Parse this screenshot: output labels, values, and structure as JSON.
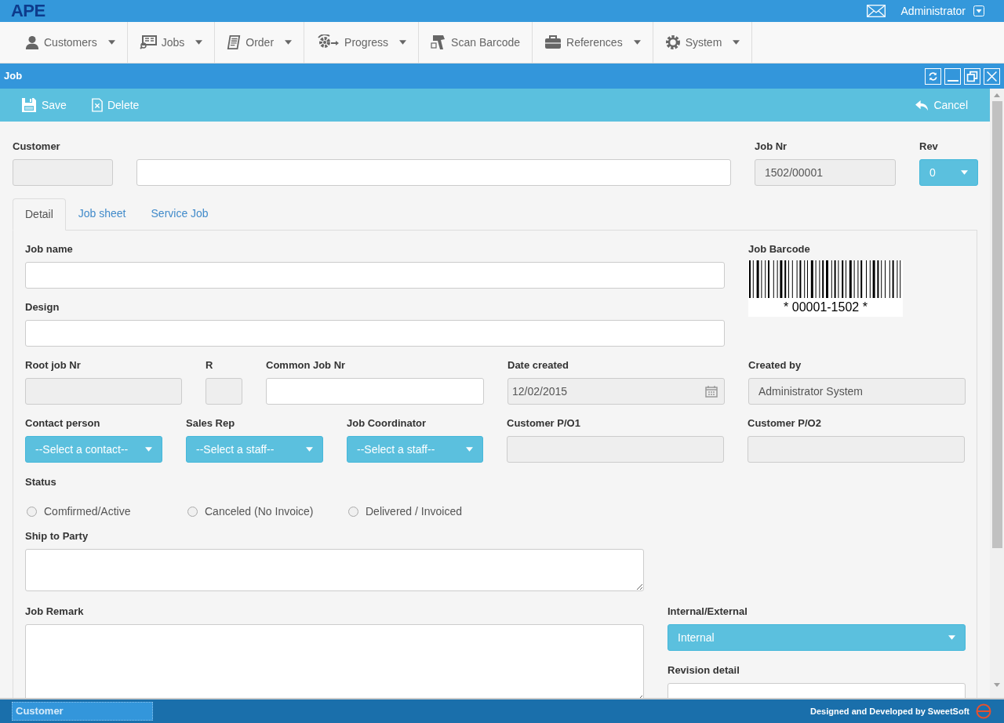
{
  "app": {
    "logo": "APE",
    "user": "Administrator"
  },
  "nav": [
    {
      "label": "Customers",
      "dropdown": true
    },
    {
      "label": "Jobs",
      "dropdown": true
    },
    {
      "label": "Order",
      "dropdown": true
    },
    {
      "label": "Progress",
      "dropdown": true
    },
    {
      "label": "Scan Barcode",
      "dropdown": false
    },
    {
      "label": "References",
      "dropdown": true
    },
    {
      "label": "System",
      "dropdown": true
    }
  ],
  "window": {
    "title": "Job"
  },
  "toolbar": {
    "actions": [
      "Save",
      "Delete"
    ],
    "cancel": "Cancel"
  },
  "header_fields": [
    {
      "kind": "text",
      "label": "Customer",
      "readonly": true
    },
    {
      "kind": "text",
      "readonly": false
    },
    {
      "kind": "text",
      "label": "Job Nr",
      "value": "1502/00001",
      "readonly": true
    },
    {
      "kind": "select",
      "label": "Rev",
      "value": "0"
    }
  ],
  "tabs": [
    {
      "label": "Detail",
      "selected": true
    },
    {
      "label": "Job sheet",
      "selected": false
    },
    {
      "label": "Service Job",
      "selected": false
    }
  ],
  "detail": {
    "top": [
      {
        "kind": "text",
        "label": "Job name",
        "readonly": false
      },
      {
        "kind": "text",
        "label": "Design",
        "readonly": false
      }
    ],
    "barcode": {
      "label": "Job Barcode",
      "text": "* 00001-1502 *"
    },
    "rows": [
      [
        {
          "kind": "text",
          "label": "Root job Nr",
          "readonly": true
        },
        {
          "kind": "text",
          "label": "R",
          "readonly": true
        },
        {
          "kind": "text",
          "label": "Common Job Nr",
          "readonly": false
        },
        {
          "kind": "date",
          "label": "Date created",
          "value": "12/02/2015",
          "readonly": true
        },
        {
          "kind": "text",
          "label": "Created by",
          "value": "Administrator System",
          "readonly": true
        }
      ],
      [
        {
          "kind": "select",
          "label": "Contact person",
          "value": "--Select a contact--"
        },
        {
          "kind": "select",
          "label": "Sales Rep",
          "value": "--Select a staff--"
        },
        {
          "kind": "select",
          "label": "Job Coordinator",
          "value": "--Select a staff--"
        },
        {
          "kind": "text",
          "label": "Customer P/O1",
          "readonly": true
        },
        {
          "kind": "text",
          "label": "Customer P/O2",
          "readonly": true
        }
      ]
    ],
    "status": {
      "label": "Status",
      "options": [
        {
          "label": "Comfirmed/Active",
          "selected": false
        },
        {
          "label": "Canceled (No Invoice)",
          "selected": false
        },
        {
          "label": "Delivered / Invoiced",
          "selected": false
        }
      ]
    },
    "ship_to": {
      "kind": "textarea",
      "label": "Ship to Party"
    },
    "remark": {
      "kind": "textarea",
      "label": "Job Remark"
    },
    "side": [
      {
        "kind": "select",
        "label": "Internal/External",
        "value": "Internal"
      },
      {
        "kind": "text",
        "label": "Revision detail",
        "readonly": false
      }
    ]
  },
  "footer": {
    "task": "Customer",
    "credit": "Designed and Developed by SweetSoft"
  }
}
